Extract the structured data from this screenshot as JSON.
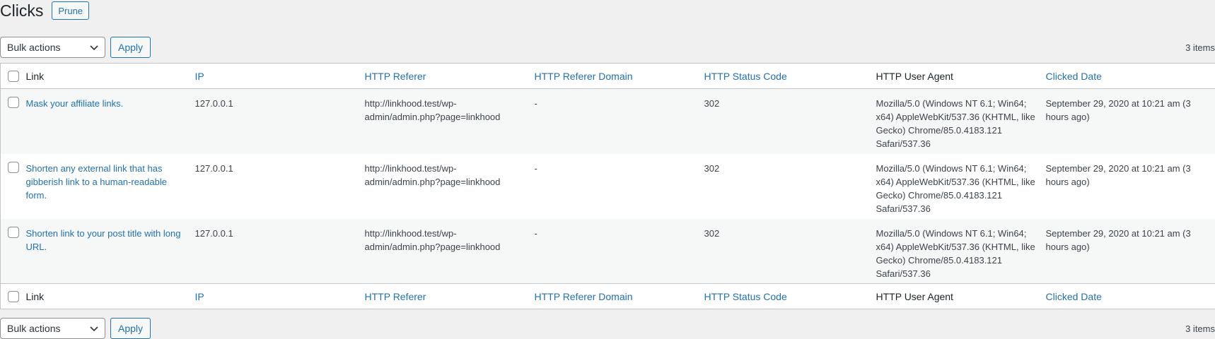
{
  "header": {
    "title": "Clicks",
    "prune_label": "Prune"
  },
  "tablenav": {
    "bulk_actions_label": "Bulk actions",
    "apply_label": "Apply",
    "items_count": "3 items"
  },
  "columns": [
    {
      "label": "Link",
      "sortable": false
    },
    {
      "label": "IP",
      "sortable": true
    },
    {
      "label": "HTTP Referer",
      "sortable": true
    },
    {
      "label": "HTTP Referer Domain",
      "sortable": true
    },
    {
      "label": "HTTP Status Code",
      "sortable": true
    },
    {
      "label": "HTTP User Agent",
      "sortable": false
    },
    {
      "label": "Clicked Date",
      "sortable": true
    }
  ],
  "rows": [
    {
      "link": "Mask your affiliate links.",
      "ip": "127.0.0.1",
      "referer": "http://linkhood.test/wp-admin/admin.php?page=linkhood",
      "referer_domain": "-",
      "status_code": "302",
      "user_agent": "Mozilla/5.0 (Windows NT 6.1; Win64; x64) AppleWebKit/537.36 (KHTML, like Gecko) Chrome/85.0.4183.121 Safari/537.36",
      "clicked_date": "September 29, 2020 at 10:21 am (3 hours ago)"
    },
    {
      "link": "Shorten any external link that has gibberish link to a human-readable form.",
      "ip": "127.0.0.1",
      "referer": "http://linkhood.test/wp-admin/admin.php?page=linkhood",
      "referer_domain": "-",
      "status_code": "302",
      "user_agent": "Mozilla/5.0 (Windows NT 6.1; Win64; x64) AppleWebKit/537.36 (KHTML, like Gecko) Chrome/85.0.4183.121 Safari/537.36",
      "clicked_date": "September 29, 2020 at 10:21 am (3 hours ago)"
    },
    {
      "link": "Shorten link to your post title with long URL.",
      "ip": "127.0.0.1",
      "referer": "http://linkhood.test/wp-admin/admin.php?page=linkhood",
      "referer_domain": "-",
      "status_code": "302",
      "user_agent": "Mozilla/5.0 (Windows NT 6.1; Win64; x64) AppleWebKit/537.36 (KHTML, like Gecko) Chrome/85.0.4183.121 Safari/537.36",
      "clicked_date": "September 29, 2020 at 10:21 am (3 hours ago)"
    }
  ],
  "colors": {
    "link": "#2271b1",
    "border": "#c3c4c7",
    "background": "#f0f0f1",
    "alt_row": "#f6f7f7"
  },
  "icons": {
    "select_arrow": "chevron-down-icon"
  }
}
